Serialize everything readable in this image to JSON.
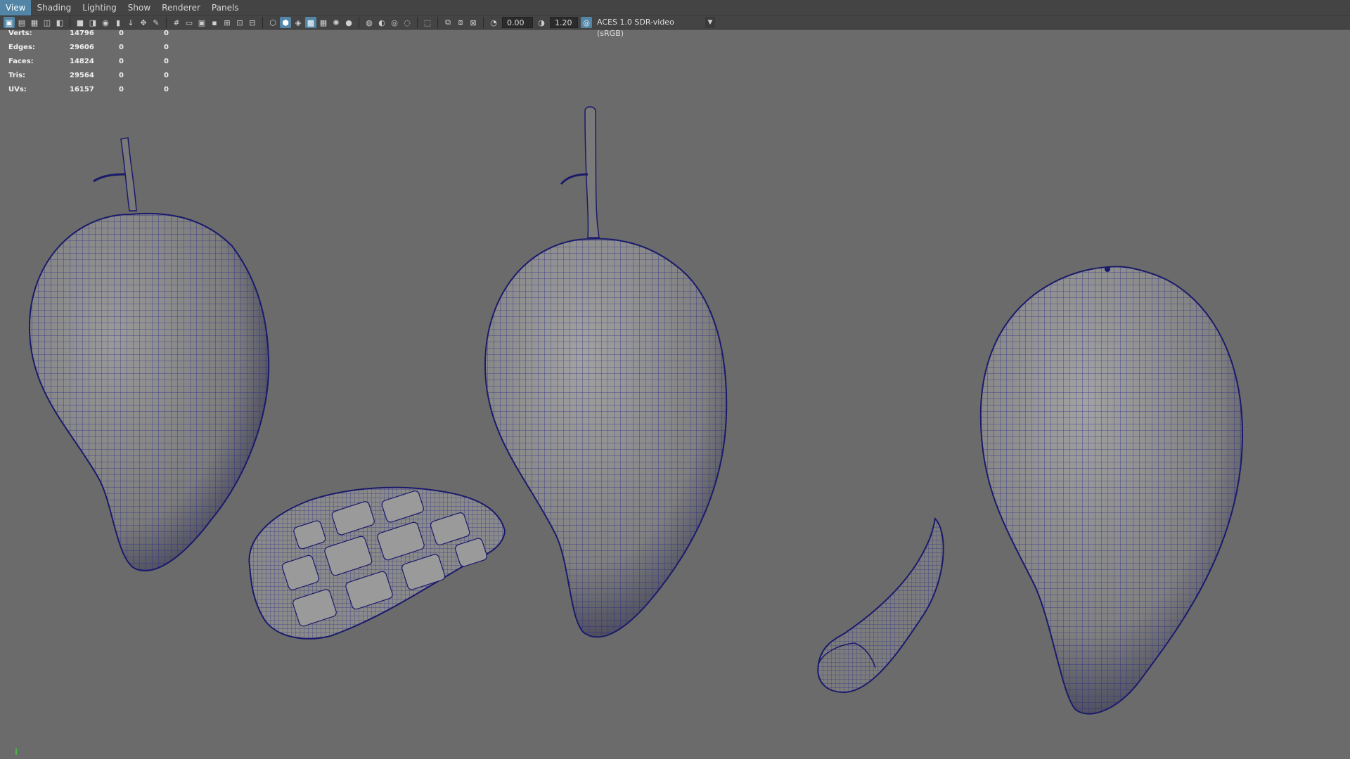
{
  "menu": {
    "items": [
      "View",
      "Shading",
      "Lighting",
      "Show",
      "Renderer",
      "Panels"
    ],
    "active": "View"
  },
  "toolbar": {
    "exposure_value": "0.00",
    "gamma_value": "1.20",
    "color_space": "ACES 1.0 SDR-video (sRGB)"
  },
  "hud": {
    "rows": [
      {
        "label": "Verts:",
        "values": [
          "14796",
          "0",
          "0"
        ]
      },
      {
        "label": "Edges:",
        "values": [
          "29606",
          "0",
          "0"
        ]
      },
      {
        "label": "Faces:",
        "values": [
          "14824",
          "0",
          "0"
        ]
      },
      {
        "label": "Tris:",
        "values": [
          "29564",
          "0",
          "0"
        ]
      },
      {
        "label": "UVs:",
        "values": [
          "16157",
          "0",
          "0"
        ]
      }
    ]
  },
  "colors": {
    "viewport_bg": "#6b6b6b",
    "wire": "#1a1a7a",
    "menu_active": "#5285a6"
  },
  "icons": {
    "toolbar": [
      "select-camera-icon",
      "camera-attributes-icon",
      "bookmark-icon",
      "image-plane-icon",
      "film-gate-icon",
      "grid-icon",
      "resolution-gate-icon",
      "wireframe-icon",
      "smooth-shade-icon",
      "wireframe-on-shaded-icon",
      "textured-icon",
      "lights-icon",
      "shadows-icon",
      "xray-icon",
      "isolate-select-icon",
      "exposure-icon",
      "gamma-icon",
      "color-management-icon"
    ]
  }
}
